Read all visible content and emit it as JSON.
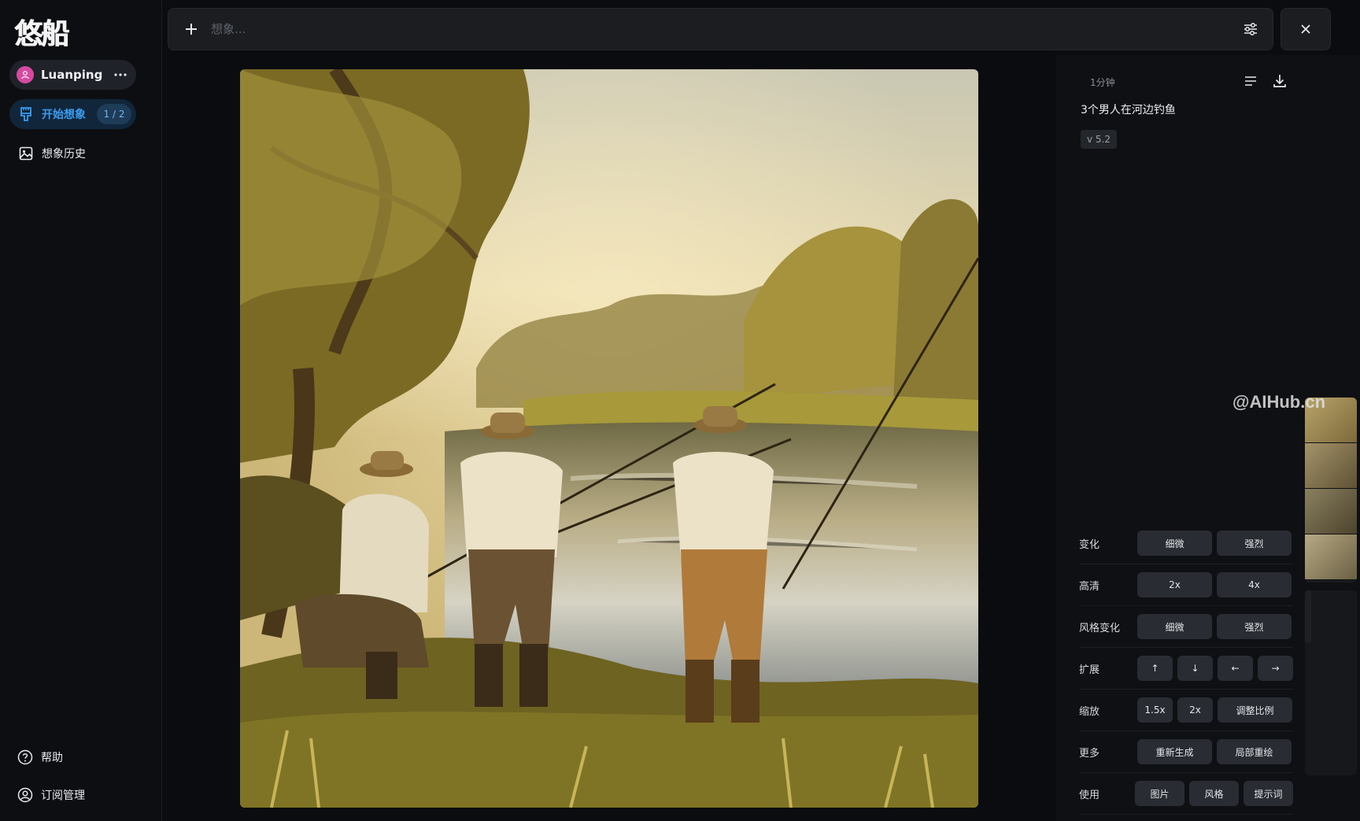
{
  "app": {
    "logo_text": "悠船"
  },
  "sidebar": {
    "user": {
      "name": "Luanping"
    },
    "nav": {
      "start": {
        "label": "开始想象",
        "count": "1 / 2"
      },
      "history": {
        "label": "想象历史"
      }
    },
    "bottom": {
      "help": "帮助",
      "subscription": "订阅管理"
    }
  },
  "prompt_bar": {
    "placeholder": "想象..."
  },
  "detail": {
    "time": "1分钟",
    "prompt": "3个男人在河边钓鱼",
    "version": "v 5.2",
    "watermark": "@AIHub.cn"
  },
  "actions": [
    {
      "label": "变化",
      "buttons": [
        "细微",
        "强烈"
      ]
    },
    {
      "label": "高清",
      "buttons": [
        "2x",
        "4x"
      ]
    },
    {
      "label": "风格变化",
      "buttons": [
        "细微",
        "强烈"
      ]
    },
    {
      "label": "扩展",
      "buttons": [
        "↑",
        "↓",
        "←",
        "→"
      ]
    },
    {
      "label": "缩放",
      "buttons": [
        "1.5x",
        "2x",
        "调整比例"
      ]
    },
    {
      "label": "更多",
      "buttons": [
        "重新生成",
        "局部重绘"
      ]
    },
    {
      "label": "使用",
      "buttons": [
        "图片",
        "风格",
        "提示词"
      ]
    }
  ],
  "colors": {
    "accent": "#3b9cf0",
    "avatar": "#d64aa0",
    "background": "#0b0c0f"
  }
}
